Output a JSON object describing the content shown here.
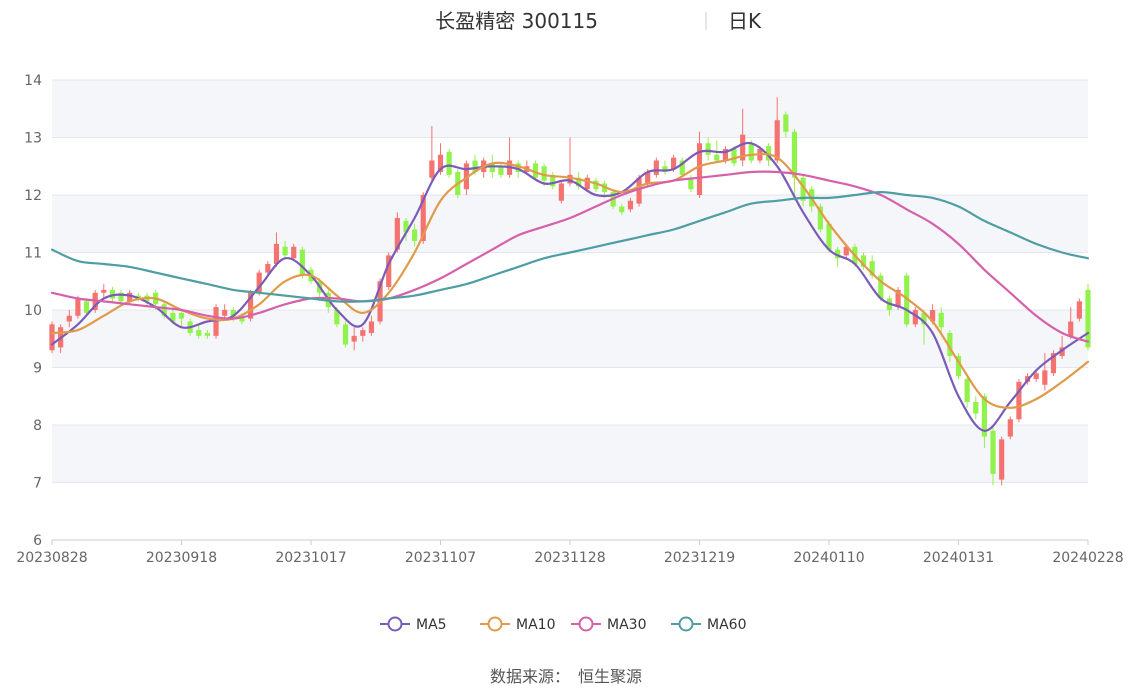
{
  "header": {
    "stock_name": "长盈精密 300115",
    "period_label": "日K"
  },
  "footer": {
    "source_label": "数据来源：",
    "source_name": "恒生聚源"
  },
  "colors": {
    "up": "#f4726f",
    "down": "#92f24c",
    "ma5": "#7a5cb8",
    "ma10": "#e09a4a",
    "ma30": "#d660aa",
    "ma60": "#4e9ea3",
    "band": "#f5f6fa",
    "grid": "#e4e7ef"
  },
  "chart_data": {
    "type": "candlestick",
    "title": "长盈精密 300115",
    "period": "日K",
    "ylim": [
      6,
      14
    ],
    "yticks": [
      6,
      7,
      8,
      9,
      10,
      11,
      12,
      13,
      14
    ],
    "x_tick_labels": [
      "20230828",
      "20230918",
      "20231017",
      "20231107",
      "20231128",
      "20231219",
      "20240110",
      "20240131",
      "20240228"
    ],
    "x_tick_index": [
      0,
      15,
      30,
      45,
      60,
      75,
      90,
      105,
      120
    ],
    "dates_range": [
      "20230828",
      "20240228"
    ],
    "legend": [
      "MA5",
      "MA10",
      "MA30",
      "MA60"
    ],
    "legend_position": "bottom",
    "candles": [
      {
        "o": 9.3,
        "c": 9.75,
        "h": 9.8,
        "l": 9.25
      },
      {
        "o": 9.35,
        "c": 9.7,
        "h": 9.75,
        "l": 9.25
      },
      {
        "o": 9.8,
        "c": 9.9,
        "h": 10.0,
        "l": 9.7
      },
      {
        "o": 9.9,
        "c": 10.2,
        "h": 10.25,
        "l": 9.85
      },
      {
        "o": 10.15,
        "c": 9.95,
        "h": 10.2,
        "l": 9.9
      },
      {
        "o": 10.0,
        "c": 10.3,
        "h": 10.35,
        "l": 9.95
      },
      {
        "o": 10.3,
        "c": 10.35,
        "h": 10.45,
        "l": 10.2
      },
      {
        "o": 10.35,
        "c": 10.2,
        "h": 10.4,
        "l": 10.15
      },
      {
        "o": 10.3,
        "c": 10.15,
        "h": 10.35,
        "l": 10.1
      },
      {
        "o": 10.15,
        "c": 10.3,
        "h": 10.35,
        "l": 10.1
      },
      {
        "o": 10.25,
        "c": 10.2,
        "h": 10.3,
        "l": 10.15
      },
      {
        "o": 10.25,
        "c": 10.15,
        "h": 10.3,
        "l": 10.05
      },
      {
        "o": 10.3,
        "c": 10.1,
        "h": 10.35,
        "l": 10.0
      },
      {
        "o": 10.1,
        "c": 9.9,
        "h": 10.15,
        "l": 9.85
      },
      {
        "o": 9.95,
        "c": 9.8,
        "h": 10.05,
        "l": 9.75
      },
      {
        "o": 9.95,
        "c": 9.85,
        "h": 10.0,
        "l": 9.7
      },
      {
        "o": 9.8,
        "c": 9.6,
        "h": 9.85,
        "l": 9.55
      },
      {
        "o": 9.65,
        "c": 9.55,
        "h": 9.75,
        "l": 9.5
      },
      {
        "o": 9.6,
        "c": 9.55,
        "h": 9.65,
        "l": 9.5
      },
      {
        "o": 9.55,
        "c": 10.05,
        "h": 10.1,
        "l": 9.5
      },
      {
        "o": 9.9,
        "c": 10.0,
        "h": 10.1,
        "l": 9.85
      },
      {
        "o": 10.0,
        "c": 9.85,
        "h": 10.05,
        "l": 9.8
      },
      {
        "o": 9.9,
        "c": 9.8,
        "h": 9.95,
        "l": 9.75
      },
      {
        "o": 9.85,
        "c": 10.3,
        "h": 10.35,
        "l": 9.8
      },
      {
        "o": 10.3,
        "c": 10.65,
        "h": 10.7,
        "l": 10.25
      },
      {
        "o": 10.65,
        "c": 10.8,
        "h": 10.85,
        "l": 10.6
      },
      {
        "o": 10.8,
        "c": 11.15,
        "h": 11.35,
        "l": 10.75
      },
      {
        "o": 11.1,
        "c": 10.95,
        "h": 11.2,
        "l": 10.9
      },
      {
        "o": 10.9,
        "c": 11.1,
        "h": 11.15,
        "l": 10.85
      },
      {
        "o": 11.05,
        "c": 10.6,
        "h": 11.1,
        "l": 10.55
      },
      {
        "o": 10.7,
        "c": 10.5,
        "h": 10.75,
        "l": 10.45
      },
      {
        "o": 10.5,
        "c": 10.3,
        "h": 10.55,
        "l": 10.2
      },
      {
        "o": 10.3,
        "c": 10.05,
        "h": 10.35,
        "l": 9.95
      },
      {
        "o": 10.0,
        "c": 9.75,
        "h": 10.05,
        "l": 9.7
      },
      {
        "o": 9.75,
        "c": 9.4,
        "h": 9.8,
        "l": 9.35
      },
      {
        "o": 9.45,
        "c": 9.55,
        "h": 9.7,
        "l": 9.3
      },
      {
        "o": 9.55,
        "c": 9.65,
        "h": 9.7,
        "l": 9.45
      },
      {
        "o": 9.6,
        "c": 9.8,
        "h": 9.9,
        "l": 9.55
      },
      {
        "o": 9.8,
        "c": 10.5,
        "h": 10.55,
        "l": 9.75
      },
      {
        "o": 10.4,
        "c": 10.95,
        "h": 11.0,
        "l": 10.35
      },
      {
        "o": 11.05,
        "c": 11.6,
        "h": 11.7,
        "l": 11.0
      },
      {
        "o": 11.55,
        "c": 11.35,
        "h": 11.6,
        "l": 11.2
      },
      {
        "o": 11.4,
        "c": 11.2,
        "h": 11.5,
        "l": 11.1
      },
      {
        "o": 11.2,
        "c": 12.0,
        "h": 12.05,
        "l": 11.15
      },
      {
        "o": 12.3,
        "c": 12.6,
        "h": 13.2,
        "l": 12.25
      },
      {
        "o": 12.4,
        "c": 12.7,
        "h": 12.9,
        "l": 12.35
      },
      {
        "o": 12.75,
        "c": 12.35,
        "h": 12.8,
        "l": 12.3
      },
      {
        "o": 12.4,
        "c": 12.0,
        "h": 12.45,
        "l": 11.95
      },
      {
        "o": 12.1,
        "c": 12.55,
        "h": 12.6,
        "l": 12.0
      },
      {
        "o": 12.6,
        "c": 12.4,
        "h": 12.7,
        "l": 12.35
      },
      {
        "o": 12.4,
        "c": 12.6,
        "h": 12.65,
        "l": 12.3
      },
      {
        "o": 12.55,
        "c": 12.4,
        "h": 12.7,
        "l": 12.3
      },
      {
        "o": 12.5,
        "c": 12.35,
        "h": 12.55,
        "l": 12.3
      },
      {
        "o": 12.35,
        "c": 12.6,
        "h": 13.0,
        "l": 12.3
      },
      {
        "o": 12.55,
        "c": 12.4,
        "h": 12.6,
        "l": 12.3
      },
      {
        "o": 12.4,
        "c": 12.5,
        "h": 12.6,
        "l": 12.35
      },
      {
        "o": 12.55,
        "c": 12.3,
        "h": 12.6,
        "l": 12.25
      },
      {
        "o": 12.5,
        "c": 12.25,
        "h": 12.55,
        "l": 12.15
      },
      {
        "o": 12.35,
        "c": 12.15,
        "h": 12.4,
        "l": 12.1
      },
      {
        "o": 11.9,
        "c": 12.2,
        "h": 12.25,
        "l": 11.85
      },
      {
        "o": 12.2,
        "c": 12.35,
        "h": 13.0,
        "l": 12.15
      },
      {
        "o": 12.3,
        "c": 12.15,
        "h": 12.4,
        "l": 12.1
      },
      {
        "o": 12.1,
        "c": 12.3,
        "h": 12.35,
        "l": 12.05
      },
      {
        "o": 12.25,
        "c": 12.1,
        "h": 12.3,
        "l": 12.05
      },
      {
        "o": 12.2,
        "c": 12.05,
        "h": 12.25,
        "l": 11.95
      },
      {
        "o": 12.05,
        "c": 11.8,
        "h": 12.1,
        "l": 11.75
      },
      {
        "o": 11.8,
        "c": 11.7,
        "h": 11.85,
        "l": 11.65
      },
      {
        "o": 11.75,
        "c": 11.9,
        "h": 11.95,
        "l": 11.7
      },
      {
        "o": 11.85,
        "c": 12.3,
        "h": 12.35,
        "l": 11.8
      },
      {
        "o": 12.2,
        "c": 12.4,
        "h": 12.45,
        "l": 12.15
      },
      {
        "o": 12.35,
        "c": 12.6,
        "h": 12.65,
        "l": 12.3
      },
      {
        "o": 12.5,
        "c": 12.4,
        "h": 12.6,
        "l": 12.35
      },
      {
        "o": 12.45,
        "c": 12.65,
        "h": 12.7,
        "l": 12.4
      },
      {
        "o": 12.6,
        "c": 12.35,
        "h": 12.65,
        "l": 12.3
      },
      {
        "o": 12.3,
        "c": 12.1,
        "h": 12.35,
        "l": 12.05
      },
      {
        "o": 12.0,
        "c": 12.9,
        "h": 13.1,
        "l": 11.95
      },
      {
        "o": 12.9,
        "c": 12.7,
        "h": 13.0,
        "l": 12.6
      },
      {
        "o": 12.7,
        "c": 12.6,
        "h": 12.95,
        "l": 12.55
      },
      {
        "o": 12.6,
        "c": 12.8,
        "h": 12.85,
        "l": 12.55
      },
      {
        "o": 12.8,
        "c": 12.55,
        "h": 12.85,
        "l": 12.5
      },
      {
        "o": 12.6,
        "c": 13.05,
        "h": 13.5,
        "l": 12.5
      },
      {
        "o": 12.9,
        "c": 12.6,
        "h": 12.95,
        "l": 12.55
      },
      {
        "o": 12.6,
        "c": 12.8,
        "h": 12.85,
        "l": 12.55
      },
      {
        "o": 12.85,
        "c": 12.6,
        "h": 12.9,
        "l": 12.5
      },
      {
        "o": 12.6,
        "c": 13.3,
        "h": 13.7,
        "l": 12.55
      },
      {
        "o": 13.4,
        "c": 13.1,
        "h": 13.45,
        "l": 13.0
      },
      {
        "o": 13.1,
        "c": 12.3,
        "h": 13.15,
        "l": 11.9
      },
      {
        "o": 12.3,
        "c": 11.9,
        "h": 12.35,
        "l": 11.8
      },
      {
        "o": 12.1,
        "c": 11.8,
        "h": 12.15,
        "l": 11.7
      },
      {
        "o": 11.8,
        "c": 11.4,
        "h": 11.85,
        "l": 11.35
      },
      {
        "o": 11.5,
        "c": 11.05,
        "h": 11.55,
        "l": 11.0
      },
      {
        "o": 11.05,
        "c": 10.9,
        "h": 11.1,
        "l": 10.75
      },
      {
        "o": 10.95,
        "c": 11.1,
        "h": 11.15,
        "l": 10.9
      },
      {
        "o": 11.1,
        "c": 10.8,
        "h": 11.15,
        "l": 10.75
      },
      {
        "o": 10.95,
        "c": 10.75,
        "h": 11.0,
        "l": 10.7
      },
      {
        "o": 10.85,
        "c": 10.6,
        "h": 10.95,
        "l": 10.55
      },
      {
        "o": 10.6,
        "c": 10.2,
        "h": 10.65,
        "l": 10.15
      },
      {
        "o": 10.2,
        "c": 10.0,
        "h": 10.25,
        "l": 9.9
      },
      {
        "o": 10.05,
        "c": 10.35,
        "h": 10.4,
        "l": 10.0
      },
      {
        "o": 10.6,
        "c": 9.75,
        "h": 10.65,
        "l": 9.7
      },
      {
        "o": 9.75,
        "c": 10.0,
        "h": 10.05,
        "l": 9.7
      },
      {
        "o": 9.95,
        "c": 9.75,
        "h": 10.0,
        "l": 9.4
      },
      {
        "o": 9.8,
        "c": 10.0,
        "h": 10.1,
        "l": 9.75
      },
      {
        "o": 9.95,
        "c": 9.7,
        "h": 10.05,
        "l": 9.6
      },
      {
        "o": 9.6,
        "c": 9.2,
        "h": 9.65,
        "l": 9.1
      },
      {
        "o": 9.2,
        "c": 8.85,
        "h": 9.25,
        "l": 8.8
      },
      {
        "o": 8.8,
        "c": 8.4,
        "h": 8.85,
        "l": 8.3
      },
      {
        "o": 8.4,
        "c": 8.2,
        "h": 8.5,
        "l": 8.1
      },
      {
        "o": 8.5,
        "c": 7.8,
        "h": 8.55,
        "l": 7.6
      },
      {
        "o": 7.9,
        "c": 7.15,
        "h": 7.95,
        "l": 6.95
      },
      {
        "o": 7.05,
        "c": 7.75,
        "h": 7.8,
        "l": 6.95
      },
      {
        "o": 7.8,
        "c": 8.1,
        "h": 8.15,
        "l": 7.75
      },
      {
        "o": 8.1,
        "c": 8.75,
        "h": 8.8,
        "l": 8.05
      },
      {
        "o": 8.75,
        "c": 8.85,
        "h": 8.9,
        "l": 8.7
      },
      {
        "o": 8.8,
        "c": 8.9,
        "h": 8.95,
        "l": 8.75
      },
      {
        "o": 8.7,
        "c": 8.95,
        "h": 9.25,
        "l": 8.6
      },
      {
        "o": 8.9,
        "c": 9.25,
        "h": 9.3,
        "l": 8.85
      },
      {
        "o": 9.2,
        "c": 9.35,
        "h": 9.55,
        "l": 9.15
      },
      {
        "o": 9.55,
        "c": 9.8,
        "h": 10.05,
        "l": 9.5
      },
      {
        "o": 9.85,
        "c": 10.15,
        "h": 10.2,
        "l": 9.8
      },
      {
        "o": 10.35,
        "c": 9.35,
        "h": 10.45,
        "l": 9.3
      }
    ],
    "series": [
      {
        "name": "MA5",
        "x": [
          0,
          3,
          6,
          9,
          12,
          15,
          18,
          21,
          24,
          27,
          30,
          33,
          36,
          39,
          42,
          45,
          48,
          51,
          54,
          57,
          60,
          63,
          66,
          69,
          72,
          75,
          78,
          81,
          84,
          87,
          90,
          93,
          96,
          99,
          102,
          105,
          108,
          111,
          114,
          117,
          120
        ],
        "values": [
          9.4,
          9.75,
          10.2,
          10.25,
          10.05,
          9.7,
          9.8,
          9.9,
          10.4,
          10.9,
          10.6,
          10.0,
          9.75,
          10.8,
          11.6,
          12.45,
          12.45,
          12.5,
          12.45,
          12.2,
          12.25,
          12.0,
          12.05,
          12.4,
          12.45,
          12.75,
          12.75,
          12.9,
          12.5,
          11.7,
          11.05,
          10.8,
          10.2,
          10.0,
          9.6,
          8.5,
          7.9,
          8.4,
          8.95,
          9.3,
          9.6
        ]
      },
      {
        "name": "MA10",
        "x": [
          0,
          3,
          6,
          9,
          12,
          15,
          18,
          21,
          24,
          27,
          30,
          33,
          36,
          39,
          42,
          45,
          48,
          51,
          54,
          57,
          60,
          63,
          66,
          69,
          72,
          75,
          78,
          81,
          84,
          87,
          90,
          93,
          96,
          99,
          102,
          105,
          108,
          111,
          114,
          117,
          120
        ],
        "values": [
          9.6,
          9.65,
          9.9,
          10.15,
          10.2,
          10.0,
          9.85,
          9.85,
          10.1,
          10.5,
          10.6,
          10.25,
          9.95,
          10.3,
          11.0,
          11.9,
          12.3,
          12.55,
          12.5,
          12.35,
          12.3,
          12.2,
          12.05,
          12.2,
          12.25,
          12.5,
          12.6,
          12.7,
          12.65,
          12.15,
          11.5,
          10.95,
          10.5,
          10.2,
          9.8,
          9.1,
          8.45,
          8.3,
          8.45,
          8.75,
          9.1
        ]
      },
      {
        "name": "MA30",
        "x": [
          0,
          3,
          6,
          9,
          12,
          15,
          18,
          21,
          24,
          27,
          30,
          33,
          36,
          39,
          42,
          45,
          48,
          51,
          54,
          57,
          60,
          63,
          66,
          69,
          72,
          75,
          78,
          81,
          84,
          87,
          90,
          93,
          96,
          99,
          102,
          105,
          108,
          111,
          114,
          117,
          120
        ],
        "values": [
          10.3,
          10.2,
          10.15,
          10.1,
          10.05,
          10.0,
          9.9,
          9.85,
          9.95,
          10.1,
          10.2,
          10.2,
          10.15,
          10.2,
          10.35,
          10.55,
          10.8,
          11.05,
          11.3,
          11.45,
          11.6,
          11.8,
          12.0,
          12.15,
          12.25,
          12.3,
          12.35,
          12.4,
          12.4,
          12.35,
          12.25,
          12.15,
          12.0,
          11.75,
          11.5,
          11.15,
          10.7,
          10.3,
          9.9,
          9.6,
          9.45
        ]
      },
      {
        "name": "MA60",
        "x": [
          0,
          3,
          6,
          9,
          12,
          15,
          18,
          21,
          24,
          27,
          30,
          33,
          36,
          39,
          42,
          45,
          48,
          51,
          54,
          57,
          60,
          63,
          66,
          69,
          72,
          75,
          78,
          81,
          84,
          87,
          90,
          93,
          96,
          99,
          102,
          105,
          108,
          111,
          114,
          117,
          120
        ],
        "values": [
          11.05,
          10.85,
          10.8,
          10.75,
          10.65,
          10.55,
          10.45,
          10.35,
          10.3,
          10.25,
          10.2,
          10.15,
          10.15,
          10.2,
          10.25,
          10.35,
          10.45,
          10.6,
          10.75,
          10.9,
          11.0,
          11.1,
          11.2,
          11.3,
          11.4,
          11.55,
          11.7,
          11.85,
          11.9,
          11.95,
          11.95,
          12.0,
          12.05,
          12.0,
          11.95,
          11.8,
          11.55,
          11.35,
          11.15,
          11.0,
          10.9
        ]
      }
    ]
  }
}
